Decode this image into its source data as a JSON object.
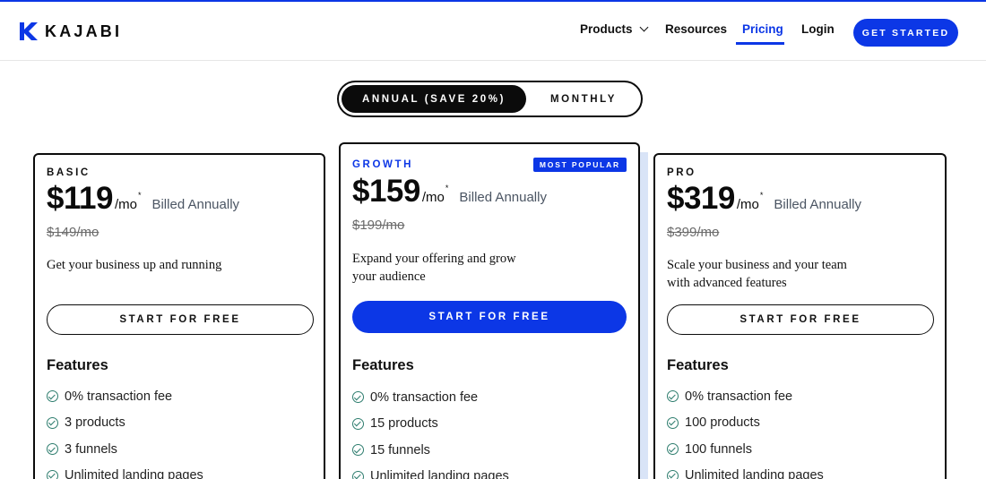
{
  "brand": {
    "name": "KAJABI"
  },
  "nav": {
    "items": [
      {
        "label": "Products"
      },
      {
        "label": "Resources"
      },
      {
        "label": "Pricing"
      },
      {
        "label": "Login"
      }
    ],
    "cta_label": "GET STARTED"
  },
  "billing_toggle": {
    "annual_label": "ANNUAL (SAVE 20%)",
    "monthly_label": "MONTHLY",
    "selected": "annual"
  },
  "plans": [
    {
      "tier": "BASIC",
      "price": "$119",
      "per": "/mo",
      "asterisk": "*",
      "billed": "Billed Annually",
      "old_price": "$149/mo",
      "description": "Get your business up and running",
      "button_label": "START FOR FREE",
      "features_title": "Features",
      "features": [
        "0% transaction fee",
        "3 products",
        "3 funnels",
        "Unlimited landing pages"
      ]
    },
    {
      "tier": "GROWTH",
      "badge": "MOST POPULAR",
      "price": "$159",
      "per": "/mo",
      "asterisk": "*",
      "billed": "Billed Annually",
      "old_price": "$199/mo",
      "description": "Expand your offering and grow your audience",
      "button_label": "START FOR FREE",
      "features_title": "Features",
      "features": [
        "0% transaction fee",
        "15 products",
        "15 funnels",
        "Unlimited landing pages"
      ]
    },
    {
      "tier": "PRO",
      "price": "$319",
      "per": "/mo",
      "asterisk": "*",
      "billed": "Billed Annually",
      "old_price": "$399/mo",
      "description": "Scale your business and your team with advanced features",
      "button_label": "START FOR FREE",
      "features_title": "Features",
      "features": [
        "0% transaction fee",
        "100 products",
        "100 funnels",
        "Unlimited landing pages"
      ]
    }
  ],
  "colors": {
    "accent": "#0c37e6",
    "dark": "#0b0b0b",
    "check": "#2e7d6e"
  }
}
